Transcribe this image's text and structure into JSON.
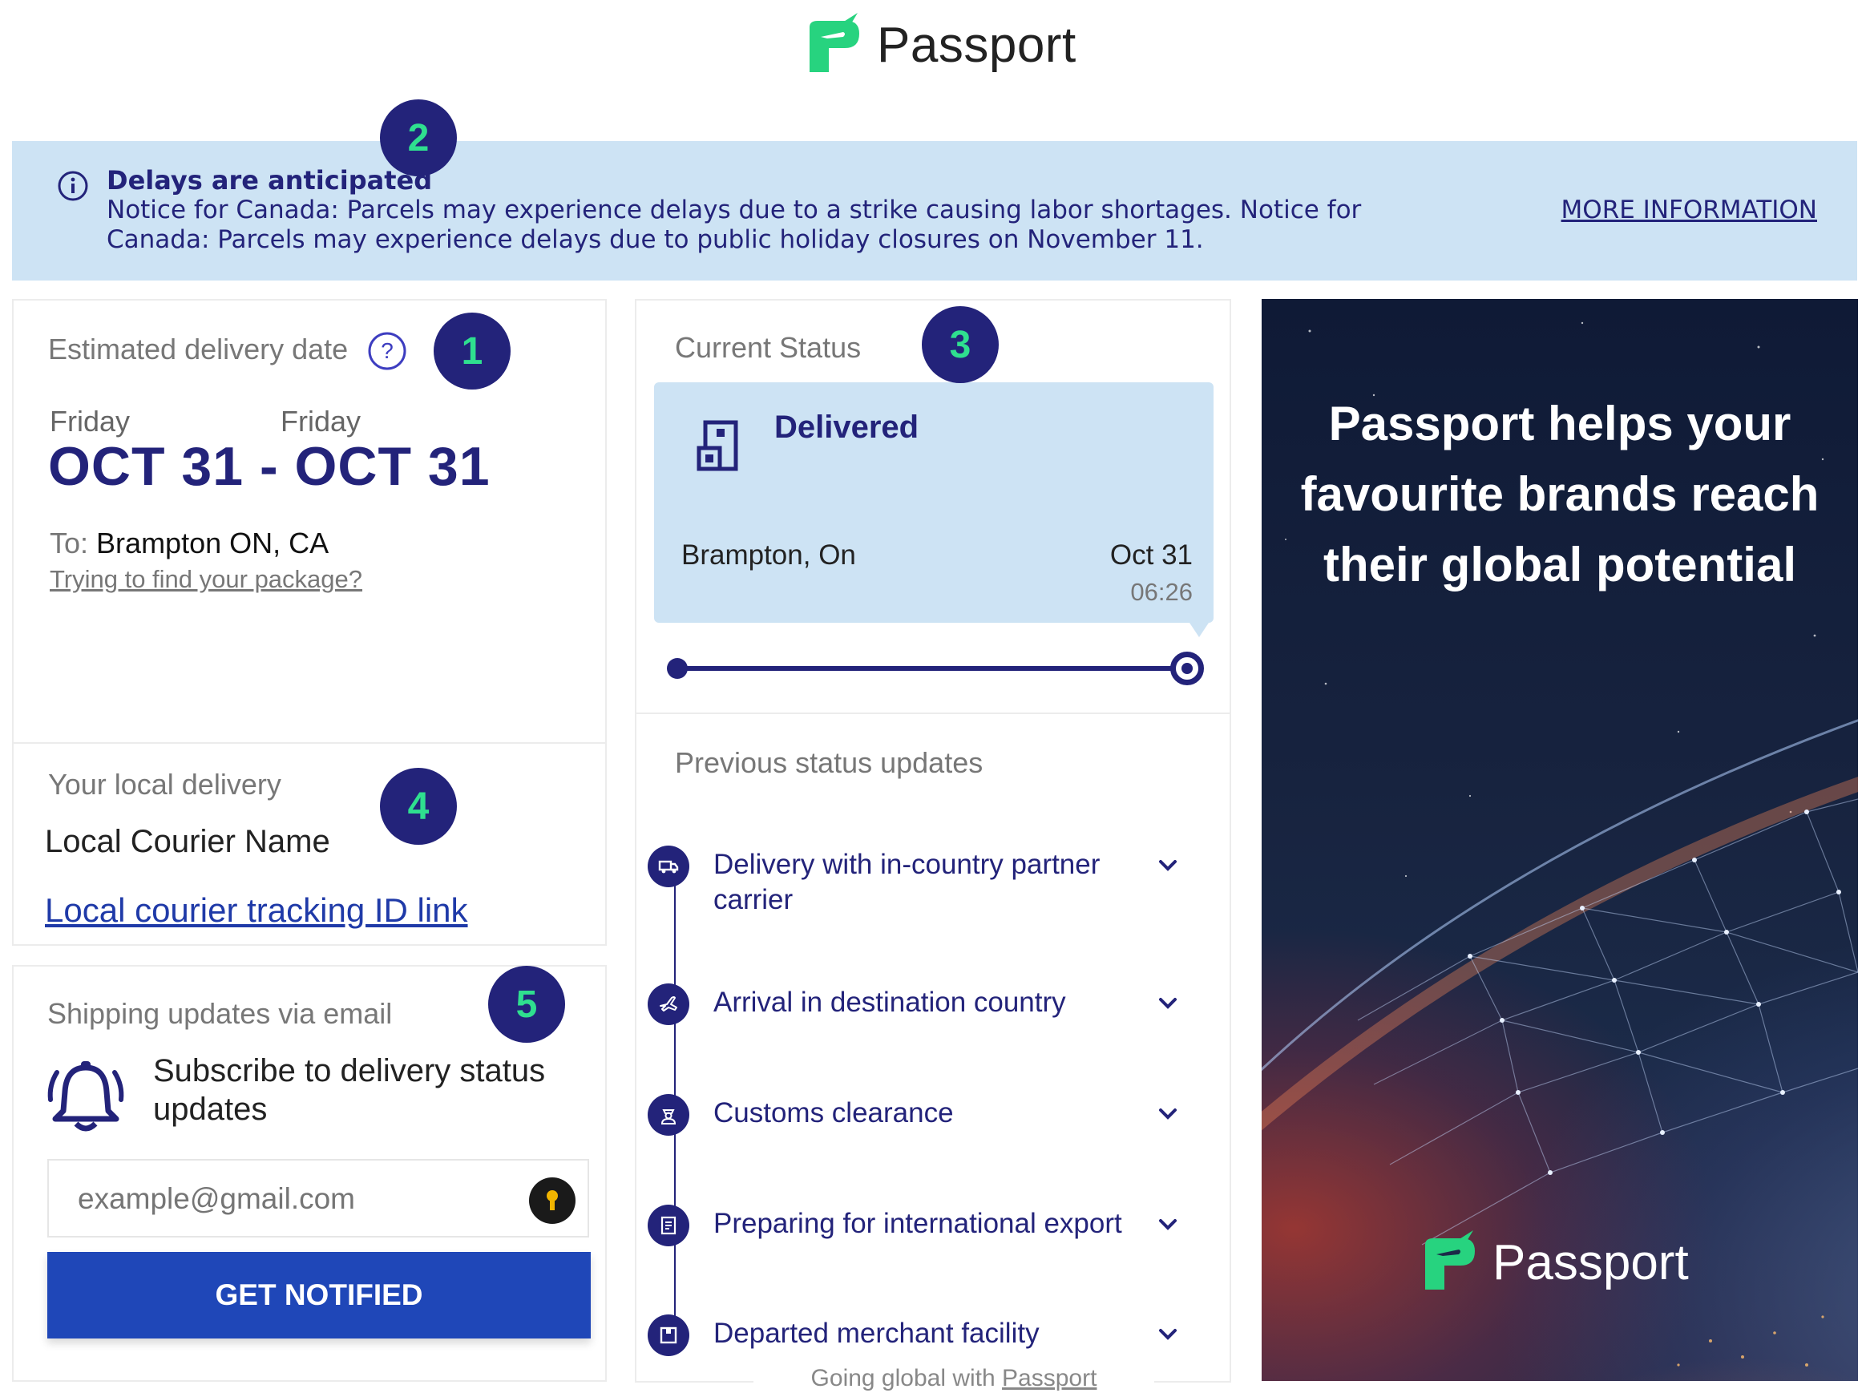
{
  "brand": {
    "name": "Passport",
    "green": "#27d37f",
    "navy": "#23237a"
  },
  "badges": [
    "1",
    "2",
    "3",
    "4",
    "5"
  ],
  "notice": {
    "title": "Delays are anticipated",
    "text": "Notice for Canada: Parcels may experience delays due to a strike causing labor shortages. Notice for Canada: Parcels may experience delays due to public holiday closures on November 11.",
    "more_link": "MORE INFORMATION"
  },
  "estimated": {
    "title": "Estimated delivery date",
    "start_day": "Friday",
    "end_day": "Friday",
    "range": "OCT 31 - OCT 31",
    "to_label": "To:",
    "to_value": "Brampton ON, CA",
    "find_link": "Trying to find your package?"
  },
  "local_delivery": {
    "title": "Your local delivery",
    "courier_name": "Local Courier Name",
    "tracking_link": "Local courier tracking ID link"
  },
  "email_updates": {
    "title": "Shipping updates via email",
    "subscribe_text": "Subscribe to delivery status updates",
    "email_placeholder": "example@gmail.com",
    "button": "GET NOTIFIED"
  },
  "current_status": {
    "title": "Current Status",
    "status": "Delivered",
    "location": "Brampton, On",
    "date": "Oct 31",
    "time": "06:26",
    "progress": 1.0
  },
  "previous_updates": {
    "title": "Previous status updates",
    "items": [
      {
        "label": "Delivery with in-country partner carrier",
        "icon": "truck-icon"
      },
      {
        "label": "Arrival in destination country",
        "icon": "plane-icon"
      },
      {
        "label": "Customs clearance",
        "icon": "customs-officer-icon"
      },
      {
        "label": "Preparing for international export",
        "icon": "document-icon"
      },
      {
        "label": "Departed merchant facility",
        "icon": "box-icon"
      }
    ]
  },
  "ad": {
    "headline": "Passport helps your favourite brands reach their global potential",
    "logo_text": "Passport"
  },
  "footer": {
    "prefix": "Going global with",
    "link": "Passport"
  }
}
